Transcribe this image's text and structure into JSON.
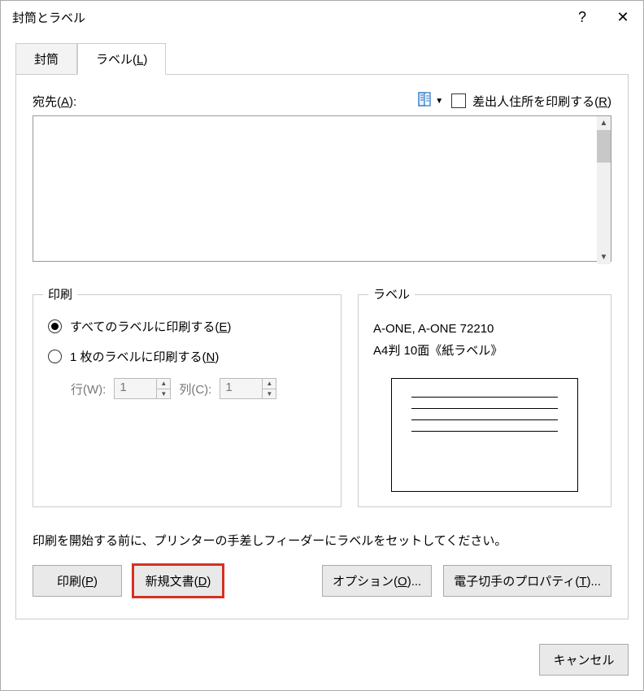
{
  "window_title": "封筒とラベル",
  "help_symbol": "?",
  "close_symbol": "✕",
  "tabs": {
    "envelope": "封筒",
    "label": "ラベル(",
    "label_key": "L",
    "label_suffix": ")"
  },
  "address": {
    "label_text": "宛先(",
    "label_key": "A",
    "label_suffix": "):",
    "value": "",
    "return_chk_text": "差出人住所を印刷する(",
    "return_chk_key": "R",
    "return_chk_suffix": ")"
  },
  "print_group": {
    "title": "印刷",
    "opt_all": "すべてのラベルに印刷する(",
    "opt_all_key": "E",
    "opt_all_suffix": ")",
    "opt_one": "1 枚のラベルに印刷する(",
    "opt_one_key": "N",
    "opt_one_suffix": ")",
    "row_label": "行(W):",
    "row_value": "1",
    "col_label": "列(C):",
    "col_value": "1"
  },
  "label_group": {
    "title": "ラベル",
    "line1": "A-ONE, A-ONE 72210",
    "line2": "A4判 10面《紙ラベル》"
  },
  "hint": "印刷を開始する前に、プリンターの手差しフィーダーにラベルをセットしてください。",
  "buttons": {
    "print": "印刷(",
    "print_key": "P",
    "print_suffix": ")",
    "newdoc": "新規文書(",
    "newdoc_key": "D",
    "newdoc_suffix": ")",
    "options": "オプション(",
    "options_key": "O",
    "options_suffix": ")...",
    "epost": "電子切手のプロパティ(",
    "epost_key": "T",
    "epost_suffix": ")...",
    "cancel": "キャンセル"
  }
}
